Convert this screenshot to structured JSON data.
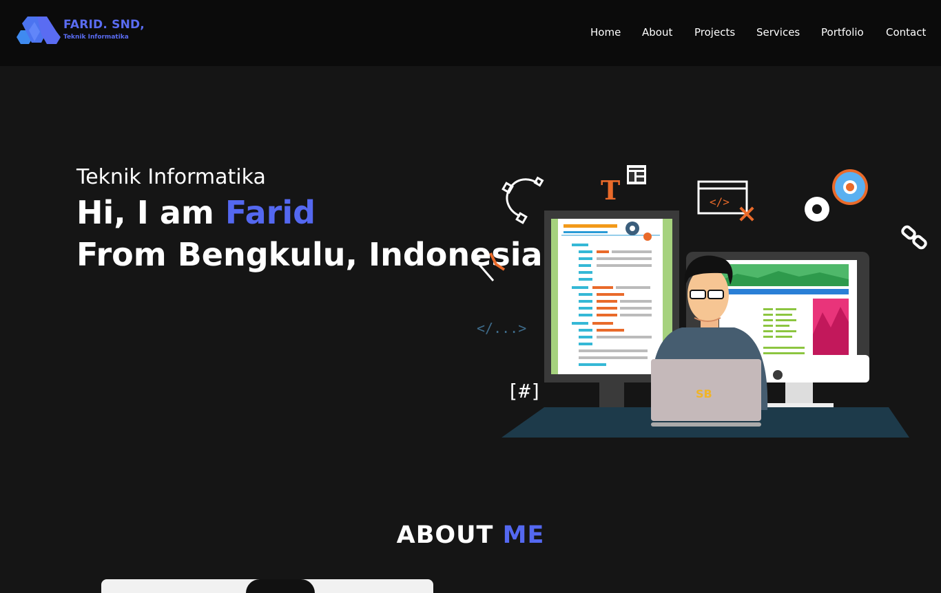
{
  "brand": {
    "title": "FARID. SND,",
    "subtitle": "Teknik Informatika",
    "logo_icon": "hexagon-m-logo",
    "color": "#5a6cf2"
  },
  "nav": {
    "items": [
      {
        "label": "Home"
      },
      {
        "label": "About"
      },
      {
        "label": "Projects"
      },
      {
        "label": "Services"
      },
      {
        "label": "Portfolio"
      },
      {
        "label": "Contact"
      }
    ]
  },
  "hero": {
    "subtitle": "Teknik Informatika",
    "greeting": "Hi, I am",
    "name": "Farid",
    "line2": "From Bengkulu, Indonesia",
    "accent_color": "#5468f0",
    "illustration": {
      "code_tag": "</...>",
      "hash_tag": "[#]",
      "letter_t": "T",
      "laptop_badge": "SB"
    }
  },
  "about": {
    "title_main": "ABOUT",
    "title_accent": "ME"
  }
}
